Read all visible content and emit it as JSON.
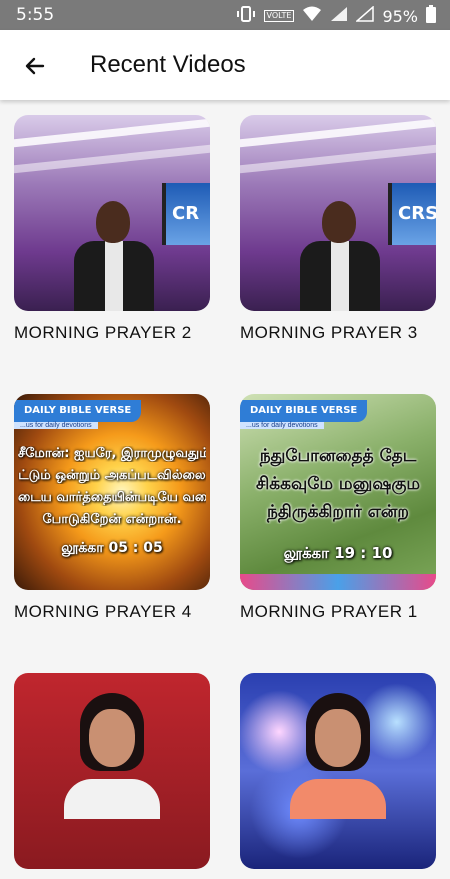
{
  "status_bar": {
    "time": "5:55",
    "battery": "95%",
    "volte_label": "VOLTE"
  },
  "app_bar": {
    "title": "Recent Videos",
    "back_icon": "arrow-left-icon"
  },
  "videos": [
    {
      "title": "MORNING PRAYER 2",
      "thumb": "studio-presenter"
    },
    {
      "title": "MORNING PRAYER 3",
      "thumb": "studio-presenter",
      "screen_text": "CRS"
    },
    {
      "title": "MORNING PRAYER 4",
      "thumb": "bible-verse-sunburst",
      "banner": "DAILY BIBLE VERSE",
      "banner_sub": "...us for daily devotions",
      "lines": [
        "சீமோன்: ஐயரே, இராமுழுவதும்",
        "ட்டும் ஒன்றும் அகப்படவில்லை",
        "டைய வார்த்தையின்படியே வலை",
        "போடுகிறேன் என்றான்."
      ],
      "reference": "லூக்கா 05 : 05"
    },
    {
      "title": "MORNING PRAYER 1",
      "thumb": "bible-verse-flowers",
      "banner": "DAILY BIBLE VERSE",
      "banner_sub": "...us for daily devotions",
      "lines": [
        "ந்துபோனதைத் தேட",
        "சிக்கவுமே மனுஷகும",
        "ந்திருக்கிறார் என்ற"
      ],
      "reference": "லூக்கா 19 : 10"
    },
    {
      "title": "",
      "thumb": "girl-red-background"
    },
    {
      "title": "",
      "thumb": "girl-bokeh-background"
    }
  ],
  "colors": {
    "app_bar_bg": "#ffffff",
    "status_bar_bg": "#7a7a7a",
    "page_bg": "#f5f5f5",
    "text": "#111111"
  }
}
